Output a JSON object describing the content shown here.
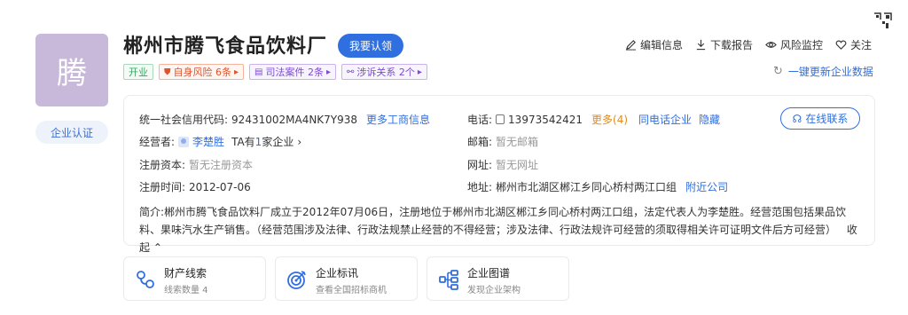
{
  "company": {
    "logo_char": "腾",
    "certification": "企业认证",
    "name": "郴州市腾飞食品饮料厂",
    "claim_button": "我要认领"
  },
  "tags": [
    {
      "label": "开业",
      "style": "green"
    },
    {
      "label": "自身风险 6条",
      "style": "orange"
    },
    {
      "label": "司法案件 2条",
      "style": "purple"
    },
    {
      "label": "涉诉关系 2个",
      "style": "purple"
    }
  ],
  "actions": {
    "edit": "编辑信息",
    "download": "下载报告",
    "monitor": "风险监控",
    "follow": "关注",
    "refresh": "一键更新企业数据"
  },
  "info": {
    "credit_code_label": "统一社会信用代码:",
    "credit_code_value": "92431002MA4NK7Y938",
    "more_business": "更多工商信息",
    "operator_label": "经营者:",
    "operator_name": "李楚胜",
    "operator_ta": "TA有",
    "operator_count": "1",
    "operator_suffix": "家企业",
    "capital_label": "注册资本:",
    "capital_value": "暂无注册资本",
    "reg_time_label": "注册时间:",
    "reg_time_value": "2012-07-06",
    "phone_label": "电话:",
    "phone_value": "13973542421",
    "phone_more": "更多(4)",
    "phone_same": "同电话企业",
    "phone_hide": "隐藏",
    "email_label": "邮箱:",
    "email_value": "暂无邮箱",
    "website_label": "网址:",
    "website_value": "暂无网址",
    "address_label": "地址:",
    "address_value": "郴州市北湖区郴江乡同心桥村两江口组",
    "address_nearby": "附近公司",
    "contact_button": "在线联系",
    "summary_label": "简介:",
    "summary_text": "郴州市腾飞食品饮料厂成立于2012年07月06日，注册地位于郴州市北湖区郴江乡同心桥村两江口组，法定代表人为李楚胜。经营范围包括果品饮料、果味汽水生产销售。（经营范围涉及法律、行政法规禁止经营的不得经营；涉及法律、行政法规许可经营的须取得相关许可证明文件后方可经营）",
    "collapse": "收起"
  },
  "bottom_cards": [
    {
      "title": "财产线索",
      "sub": "线索数量 4"
    },
    {
      "title": "企业标讯",
      "sub": "查看全国招标商机"
    },
    {
      "title": "企业图谱",
      "sub": "发现企业架构"
    }
  ],
  "colors": {
    "accent": "#2f6fe0",
    "logo_bg": "#c8b9db"
  }
}
